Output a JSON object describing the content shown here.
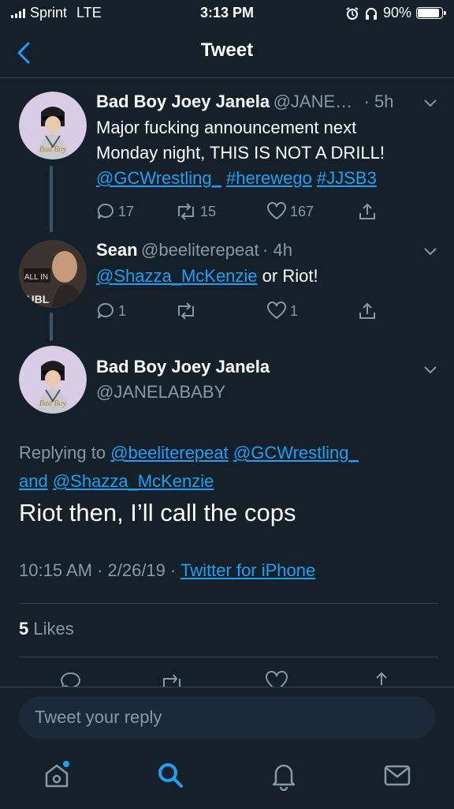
{
  "status_bar": {
    "carrier": "Sprint",
    "network": "LTE",
    "time": "3:13 PM",
    "battery_percent": "90%",
    "battery_level": 0.9
  },
  "header": {
    "title": "Tweet",
    "back_icon": "chevron-left-icon"
  },
  "tweets": [
    {
      "name": "Bad Boy Joey Janela",
      "handle": "@JANE…",
      "time": "· 5h",
      "text_line1": "Major fucking announcement next",
      "text_line2": "Monday night, THIS IS NOT A DRILL!",
      "links": [
        "@GCWrestling_",
        "#herewego",
        "#JJSB3"
      ],
      "replies": "17",
      "retweets": "15",
      "likes": "167"
    },
    {
      "name": "Sean",
      "handle": "@beeliterepeat",
      "time": "· 4h",
      "mention": "@Shazza_McKenzie",
      "text_rest": "or Riot!",
      "replies": "1",
      "retweets": "",
      "likes": "1"
    }
  ],
  "main_tweet": {
    "name": "Bad Boy Joey Janela",
    "handle": "@JANELABABY",
    "replying_to_label": "Replying to",
    "replying_to_1": "@beeliterepeat",
    "replying_to_2": "@GCWrestling_",
    "replying_to_and": "and",
    "replying_to_3": "@Shazza_McKenzie",
    "text": "Riot then, I’ll call the cops",
    "timestamp": "10:15 AM · 2/26/19 ·",
    "source": "Twitter for iPhone",
    "likes_count": "5",
    "likes_label": "Likes"
  },
  "reply_box": {
    "placeholder": "Tweet your reply"
  },
  "tab_bar": {
    "items": [
      "home-icon",
      "search-icon",
      "notifications-icon",
      "messages-icon"
    ]
  },
  "colors": {
    "background": "#15202b",
    "accent": "#1da1f2",
    "muted": "#8899a6",
    "divider": "#38444d"
  }
}
